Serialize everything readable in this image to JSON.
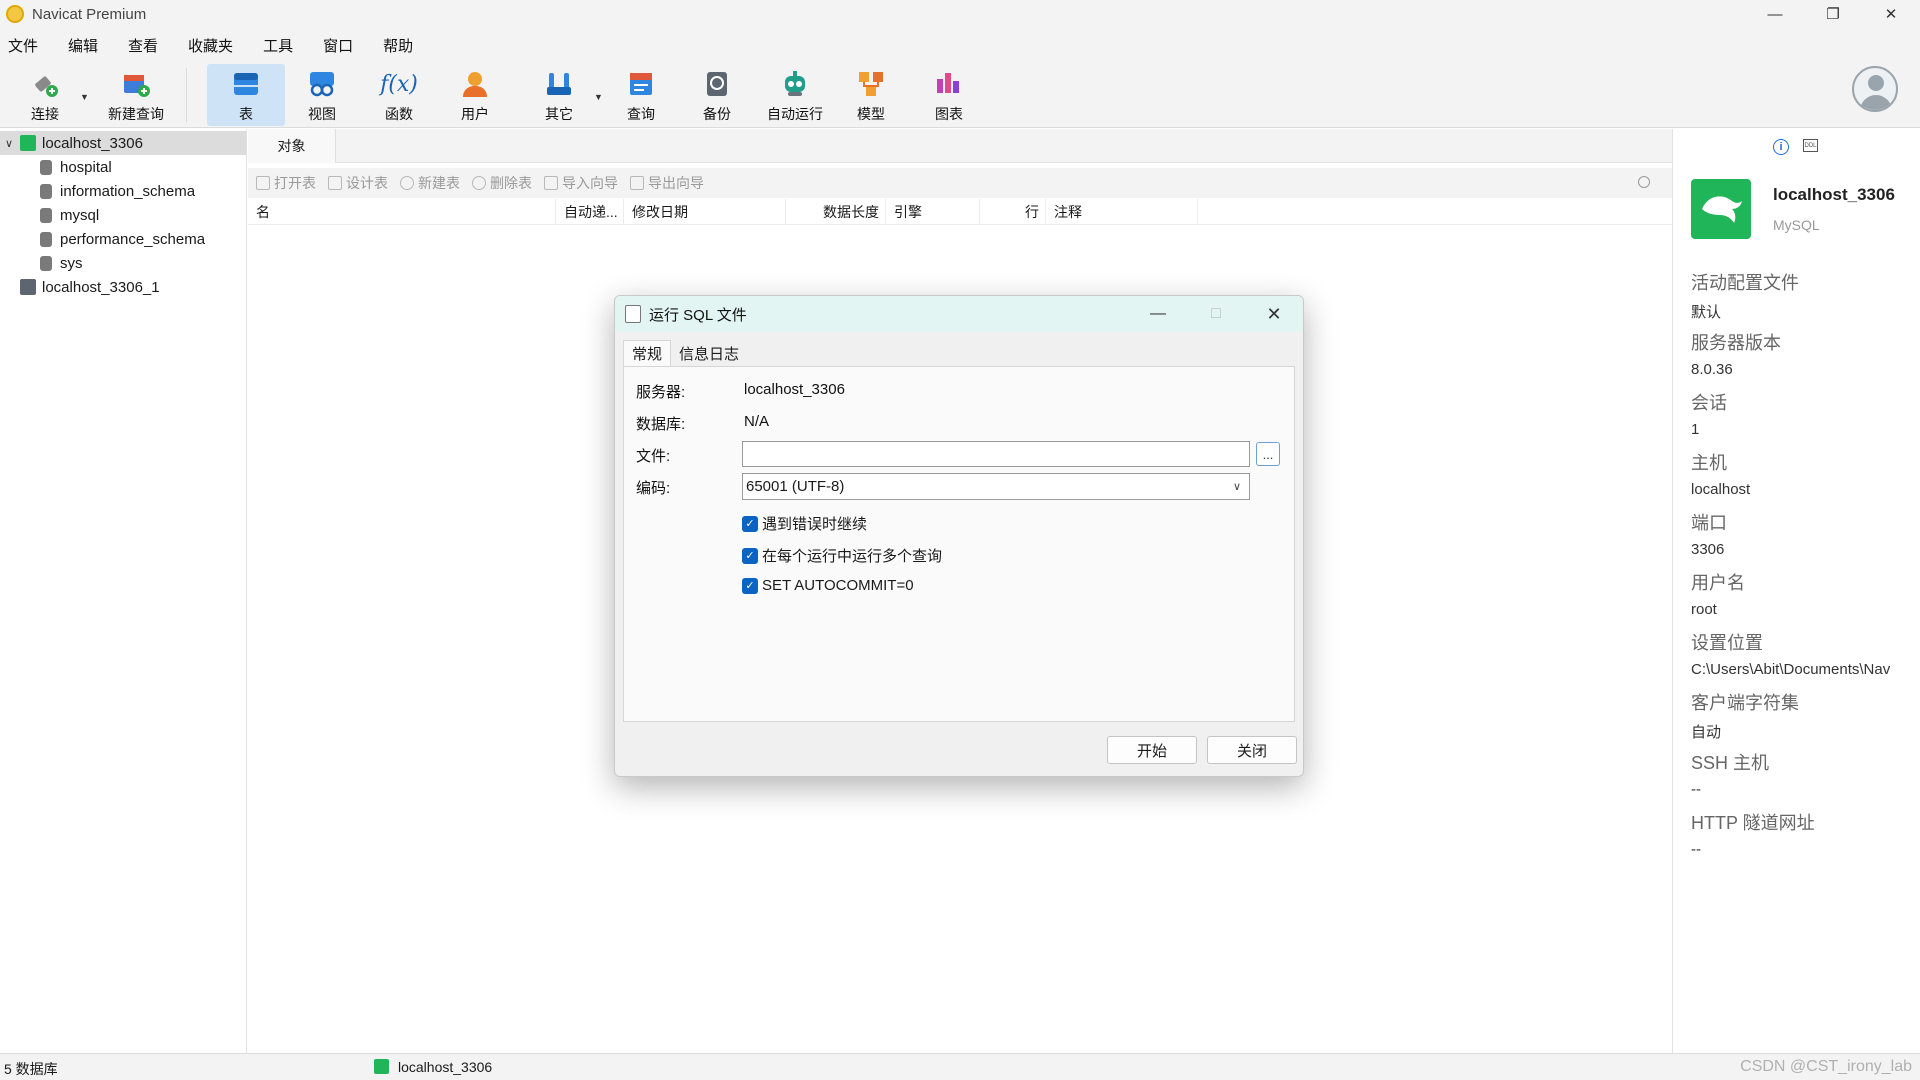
{
  "window": {
    "title": "Navicat Premium"
  },
  "menu": [
    "文件",
    "编辑",
    "查看",
    "收藏夹",
    "工具",
    "窗口",
    "帮助"
  ],
  "toolbar": {
    "connect": "连接",
    "new_query": "新建查询",
    "table": "表",
    "view": "视图",
    "function": "函数",
    "user": "用户",
    "other": "其它",
    "query": "查询",
    "backup": "备份",
    "automation": "自动运行",
    "model": "模型",
    "chart": "图表"
  },
  "tree": {
    "connection": "localhost_3306",
    "databases": [
      "hospital",
      "information_schema",
      "mysql",
      "performance_schema",
      "sys"
    ],
    "connection2": "localhost_3306_1"
  },
  "objects": {
    "tab": "对象",
    "actions": [
      "打开表",
      "设计表",
      "新建表",
      "删除表",
      "导入向导",
      "导出向导"
    ],
    "columns": [
      "名",
      "自动递...",
      "修改日期",
      "数据长度",
      "引擎",
      "行",
      "注释"
    ]
  },
  "dialog": {
    "title": "运行 SQL 文件",
    "tabs": [
      "常规",
      "信息日志"
    ],
    "server_label": "服务器:",
    "server_value": "localhost_3306",
    "database_label": "数据库:",
    "database_value": "N/A",
    "file_label": "文件:",
    "file_value": "",
    "browse": "...",
    "encoding_label": "编码:",
    "encoding_value": "65001 (UTF-8)",
    "options": [
      "遇到错误时继续",
      "在每个运行中运行多个查询",
      "SET AUTOCOMMIT=0"
    ],
    "start": "开始",
    "close": "关闭"
  },
  "info": {
    "name": "localhost_3306",
    "type": "MySQL",
    "fields": [
      {
        "label": "活动配置文件",
        "value": "默认"
      },
      {
        "label": "服务器版本",
        "value": "8.0.36"
      },
      {
        "label": "会话",
        "value": "1"
      },
      {
        "label": "主机",
        "value": "localhost"
      },
      {
        "label": "端口",
        "value": "3306"
      },
      {
        "label": "用户名",
        "value": "root"
      },
      {
        "label": "设置位置",
        "value": "C:\\Users\\Abit\\Documents\\Nav"
      },
      {
        "label": "客户端字符集",
        "value": "自动"
      },
      {
        "label": "SSH 主机",
        "value": "--"
      },
      {
        "label": "HTTP 隧道网址",
        "value": "--"
      }
    ]
  },
  "status": {
    "db_count": "5 数据库",
    "connection": "localhost_3306",
    "watermark": "CSDN @CST_irony_lab"
  },
  "colors": {
    "accent": "#0a64c2",
    "mysql_green": "#21b559",
    "active_tool": "#cfe3f7",
    "dialog_title": "#e3f5f3"
  }
}
